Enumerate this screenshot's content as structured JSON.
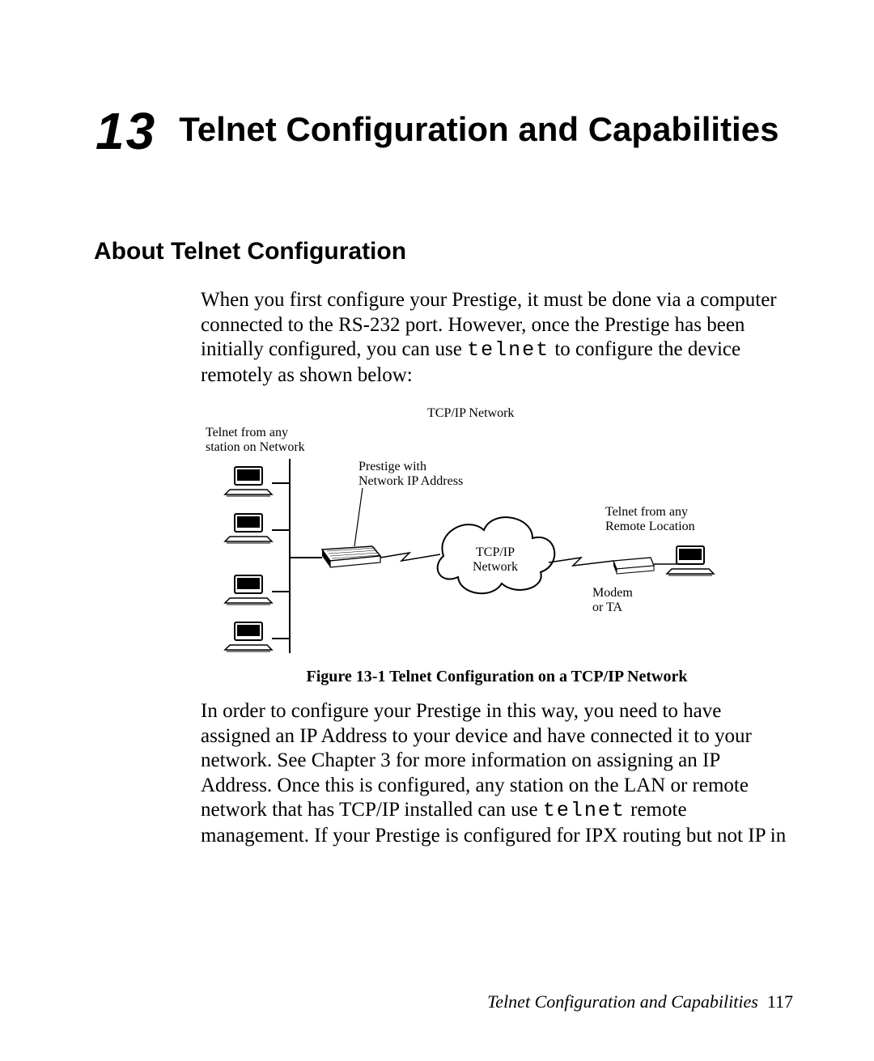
{
  "chapter": {
    "number": "13",
    "title": "Telnet Configuration and Capabilities"
  },
  "section": {
    "heading": "About Telnet Configuration",
    "para1_a": "When you first configure your Prestige, it must be done via a computer connected to the RS-232 port. However, once the Prestige has been initially configured, you can use ",
    "para1_mono": "telnet",
    "para1_b": " to configure the device remotely as shown below:",
    "para2_a": "In order to configure your Prestige in this way, you need to have assigned an IP Address to your device and have connected it to your network. See Chapter 3 for more information on assigning an IP Address. Once this is configured, any station on the LAN or remote network that has TCP/IP installed can use ",
    "para2_mono": "telnet",
    "para2_b": " remote management. If your Prestige is configured for IPX routing but not IP in"
  },
  "figure": {
    "caption": "Figure 13-1 Telnet Configuration on a TCP/IP Network",
    "labels": {
      "top": "TCP/IP Network",
      "left1": "Telnet from any",
      "left2": "station on Network",
      "center1": "Prestige with",
      "center2": "Network IP Address",
      "cloud1": "TCP/IP",
      "cloud2": "Network",
      "right1": "Telnet from any",
      "right2": "Remote Location",
      "modem1": "Modem",
      "modem2": "or TA"
    }
  },
  "footer": {
    "text": "Telnet Configuration and Capabilities",
    "page": "117"
  }
}
